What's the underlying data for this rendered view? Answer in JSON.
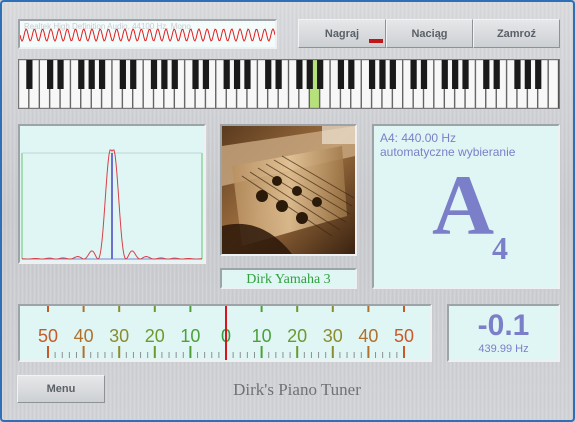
{
  "colors": {
    "accent": "#7b7fc9",
    "wave": "#e02020",
    "needle": "#d8141c",
    "panel_bg": "#e0f6f4",
    "title_text": "#6e7378"
  },
  "toolbar": {
    "record_label": "Nagraj",
    "stretch_label": "Naciąg",
    "freeze_label": "Zamroź"
  },
  "input_monitor": {
    "caption": "Realtek High Definition Audio, 44100 Hz, Mono"
  },
  "note_info": {
    "frequency_text": "A4: 440.00 Hz",
    "mode_text": "automatyczne wybieranie",
    "note_letter": "A",
    "note_octave": "4"
  },
  "piano": {
    "name": "Dirk Yamaha 3",
    "image_icon": "grand-piano-interior-photo"
  },
  "tuning_scale": {
    "labels": [
      "50",
      "40",
      "30",
      "20",
      "10",
      "0",
      "10",
      "20",
      "30",
      "40",
      "50"
    ],
    "needle_cents": 0
  },
  "deviation": {
    "cents": "-0.1",
    "frequency": "439.99 Hz"
  },
  "keyboard": {
    "white_key_count": 52,
    "highlighted_key": "A4"
  },
  "footer": {
    "menu_label": "Menu",
    "app_title": "Dirk's Piano Tuner"
  }
}
